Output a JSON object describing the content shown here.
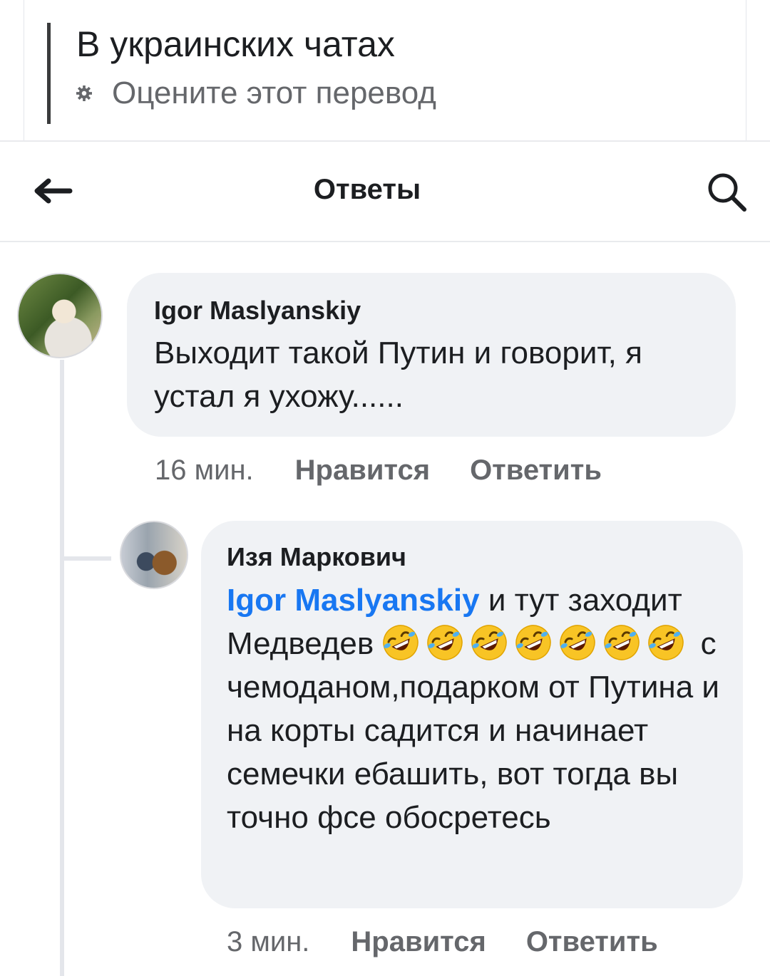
{
  "translation": {
    "text": "В украинских чатах",
    "rate_label": "Оцените этот перевод",
    "rate_icon": "gear-icon"
  },
  "header": {
    "title": "Ответы",
    "back_icon": "arrow-left-icon",
    "search_icon": "search-icon"
  },
  "comments": [
    {
      "author": "Igor Maslyanskiy",
      "text": "Выходит такой Путин и говорит,  я устал я ухожу......",
      "time": "16 мин.",
      "like_label": "Нравится",
      "reply_label": "Ответить"
    },
    {
      "author": "Изя Маркович",
      "mention": "Igor Maslyanskiy",
      "text_part1": " и тут заходит Медведев ",
      "emoji_name": "rolling-on-floor-laughing-emoji",
      "emoji_count": 7,
      "text_part2": " с чемоданом,подарком от Путина и на корты садится и начинает семечки ебашить, вот тогда вы точно фсе обосретесь",
      "time": "3 мин.",
      "like_label": "Нравится",
      "reply_label": "Ответить"
    }
  ],
  "colors": {
    "accent": "#1877f2",
    "bubble": "#f0f2f5",
    "secondary_text": "#65676b",
    "primary_text": "#1c1e21"
  }
}
